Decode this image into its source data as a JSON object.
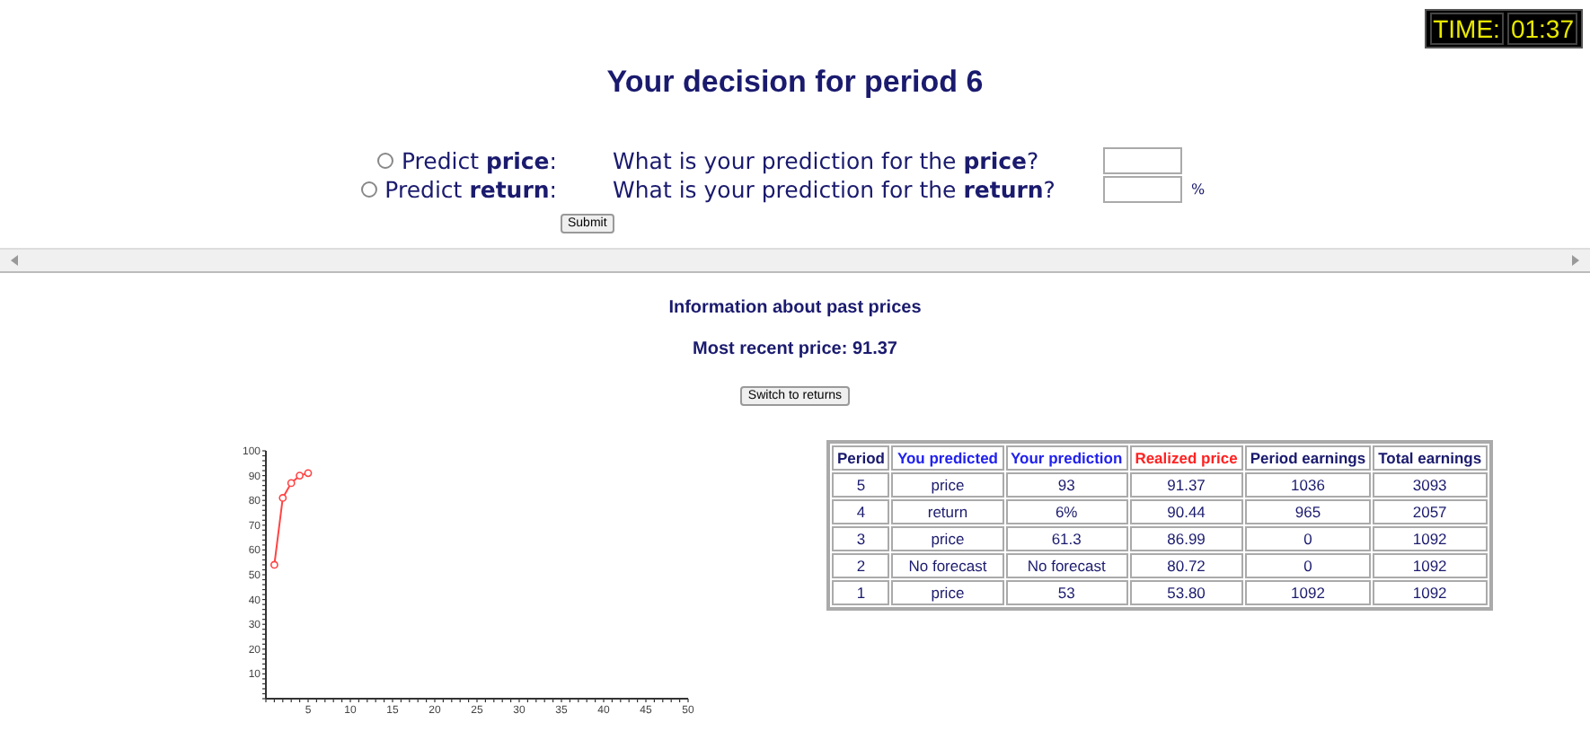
{
  "timer": {
    "label": "TIME:",
    "value": "01:37"
  },
  "title": "Your decision for period 6",
  "predictions": [
    {
      "label": "Predict **price**:",
      "selected": false,
      "question": "What is your prediction for the **price**?"
    },
    {
      "label": "Predict **return**:",
      "selected": false,
      "question": "What is your prediction for the **return**?",
      "unit": "%"
    }
  ],
  "submit_button": "Submit",
  "info": {
    "heading": "Information about past prices",
    "recent_price": "Most recent price: 91.37",
    "switch_button": "Switch to returns"
  },
  "chart_data": {
    "type": "line",
    "x": [
      1,
      2,
      3,
      4,
      5
    ],
    "series": [
      {
        "color": "#ff4444",
        "marker": "circle",
        "values": [
          54,
          81,
          87,
          90,
          91
        ]
      }
    ],
    "xlim": [
      0,
      50
    ],
    "ylim": [
      0,
      100
    ],
    "xticks": [
      5,
      10,
      15,
      20,
      25,
      30,
      35,
      40,
      45,
      50
    ],
    "yticks": [
      10,
      20,
      30,
      40,
      50,
      60,
      70,
      80,
      90,
      100
    ]
  },
  "table": {
    "columns": [
      {
        "label": "Period",
        "color": "#1a1a6e"
      },
      {
        "label": "You predicted",
        "color": "#2222ee"
      },
      {
        "label": "Your prediction",
        "color": "#2222ee"
      },
      {
        "label": "Realized price",
        "color": "#ff2222"
      },
      {
        "label": "Period earnings",
        "color": "#1a1a6e"
      },
      {
        "label": "Total earnings",
        "color": "#1a1a6e"
      }
    ],
    "rows": [
      [
        "5",
        "price",
        "93",
        "91.37",
        "1036",
        "3093"
      ],
      [
        "4",
        "return",
        "6%",
        "90.44",
        "965",
        "2057"
      ],
      [
        "3",
        "price",
        "61.3",
        "86.99",
        "0",
        "1092"
      ],
      [
        "2",
        "No forecast",
        "No forecast",
        "80.72",
        "0",
        "1092"
      ],
      [
        "1",
        "price",
        "53",
        "53.80",
        "1092",
        "1092"
      ]
    ]
  }
}
